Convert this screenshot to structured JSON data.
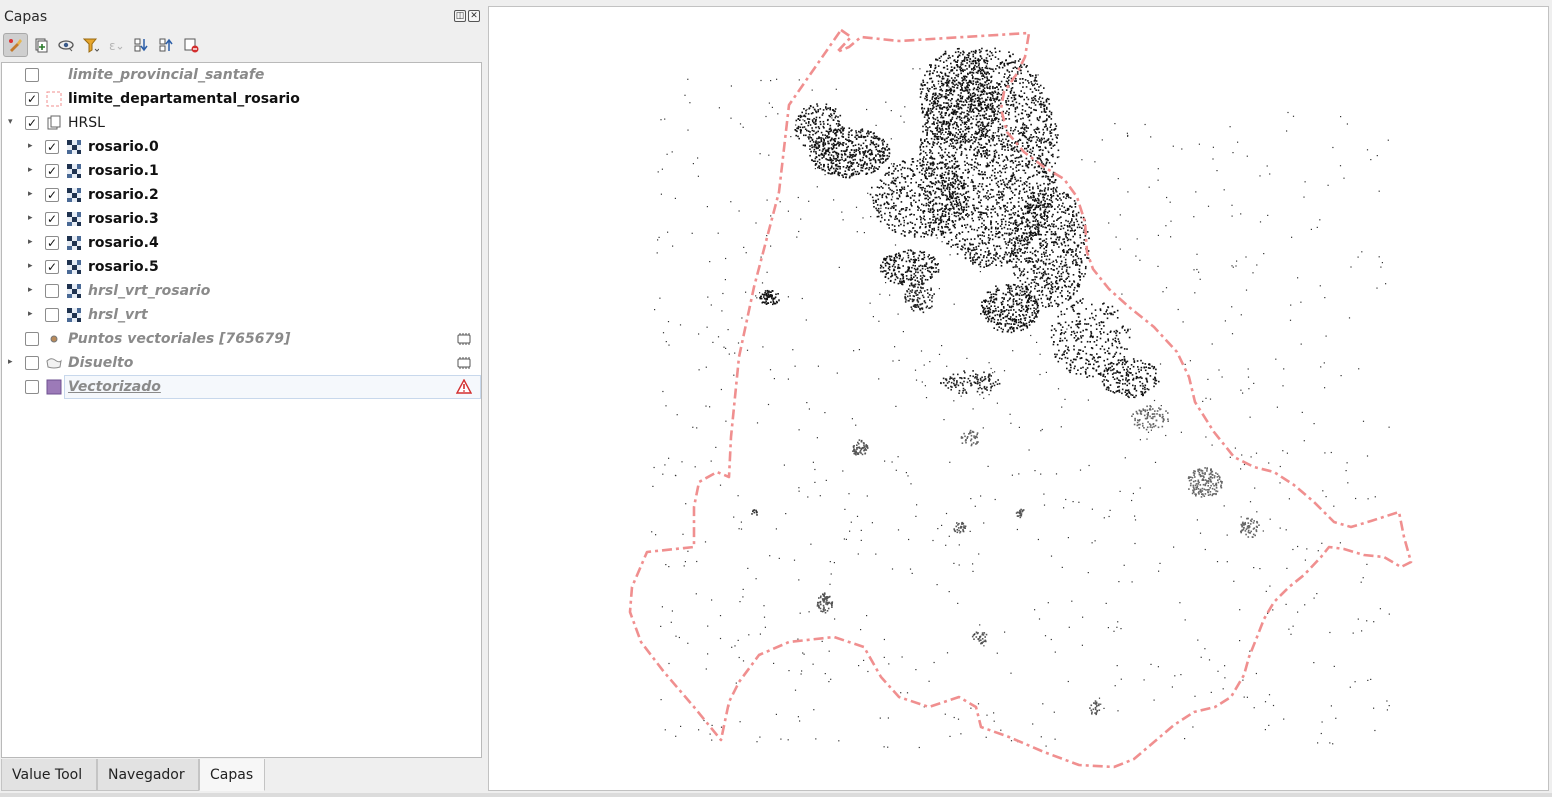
{
  "panel": {
    "title": "Capas",
    "float_btn": "◫",
    "close_btn": "✕"
  },
  "toolbar": [
    {
      "name": "style-manager-icon",
      "active": true
    },
    {
      "name": "add-group-icon",
      "active": false
    },
    {
      "name": "visibility-icon",
      "active": false
    },
    {
      "name": "filter-legend-icon",
      "active": false
    },
    {
      "name": "filter-expression-icon",
      "active": false,
      "disabled": true
    },
    {
      "name": "expand-all-icon",
      "active": false
    },
    {
      "name": "collapse-all-icon",
      "active": false
    },
    {
      "name": "remove-layer-icon",
      "active": false
    }
  ],
  "layers": [
    {
      "label": "limite_provincial_santafe",
      "checked": false,
      "style": "dim",
      "icon": "none",
      "expander": false,
      "indent": 0
    },
    {
      "label": "limite_departamental_rosario",
      "checked": true,
      "style": "bold",
      "icon": "polygon-outline",
      "expander": false,
      "indent": 0
    },
    {
      "label": "HRSL",
      "checked": true,
      "style": "plain",
      "icon": "group",
      "expander": "open",
      "indent": 0
    },
    {
      "label": "rosario.0",
      "checked": true,
      "style": "bold",
      "icon": "raster",
      "expander": "closed",
      "indent": 1
    },
    {
      "label": "rosario.1",
      "checked": true,
      "style": "bold",
      "icon": "raster",
      "expander": "closed",
      "indent": 1
    },
    {
      "label": "rosario.2",
      "checked": true,
      "style": "bold",
      "icon": "raster",
      "expander": "closed",
      "indent": 1
    },
    {
      "label": "rosario.3",
      "checked": true,
      "style": "bold",
      "icon": "raster",
      "expander": "closed",
      "indent": 1
    },
    {
      "label": "rosario.4",
      "checked": true,
      "style": "bold",
      "icon": "raster",
      "expander": "closed",
      "indent": 1
    },
    {
      "label": "rosario.5",
      "checked": true,
      "style": "bold",
      "icon": "raster",
      "expander": "closed",
      "indent": 1
    },
    {
      "label": "hrsl_vrt_rosario",
      "checked": false,
      "style": "dim",
      "icon": "raster",
      "expander": "closed",
      "indent": 1
    },
    {
      "label": "hrsl_vrt",
      "checked": false,
      "style": "dim",
      "icon": "raster",
      "expander": "closed",
      "indent": 1
    },
    {
      "label": "Puntos vectoriales [765679]",
      "checked": false,
      "style": "dim",
      "icon": "point",
      "expander": false,
      "indent": 0,
      "right_icon": "memory-layer-icon"
    },
    {
      "label": "Disuelto",
      "checked": false,
      "style": "dim",
      "icon": "polygon-fill-grey",
      "expander": "closed",
      "indent": 0,
      "right_icon": "memory-layer-icon"
    },
    {
      "label": "Vectorizado",
      "checked": false,
      "style": "dim-underline",
      "icon": "polygon-purple",
      "expander": false,
      "indent": 0,
      "right_icon": "warning-icon",
      "selected": true
    }
  ],
  "tabs": [
    {
      "label": "Value Tool",
      "current": false
    },
    {
      "label": "Navegador",
      "current": false
    },
    {
      "label": "Capas",
      "current": true
    }
  ],
  "colors": {
    "boundary": "#f08f8f",
    "purple_fill": "#9c7ab8",
    "raster_dark": "#1f3350",
    "dots": "#000000"
  }
}
